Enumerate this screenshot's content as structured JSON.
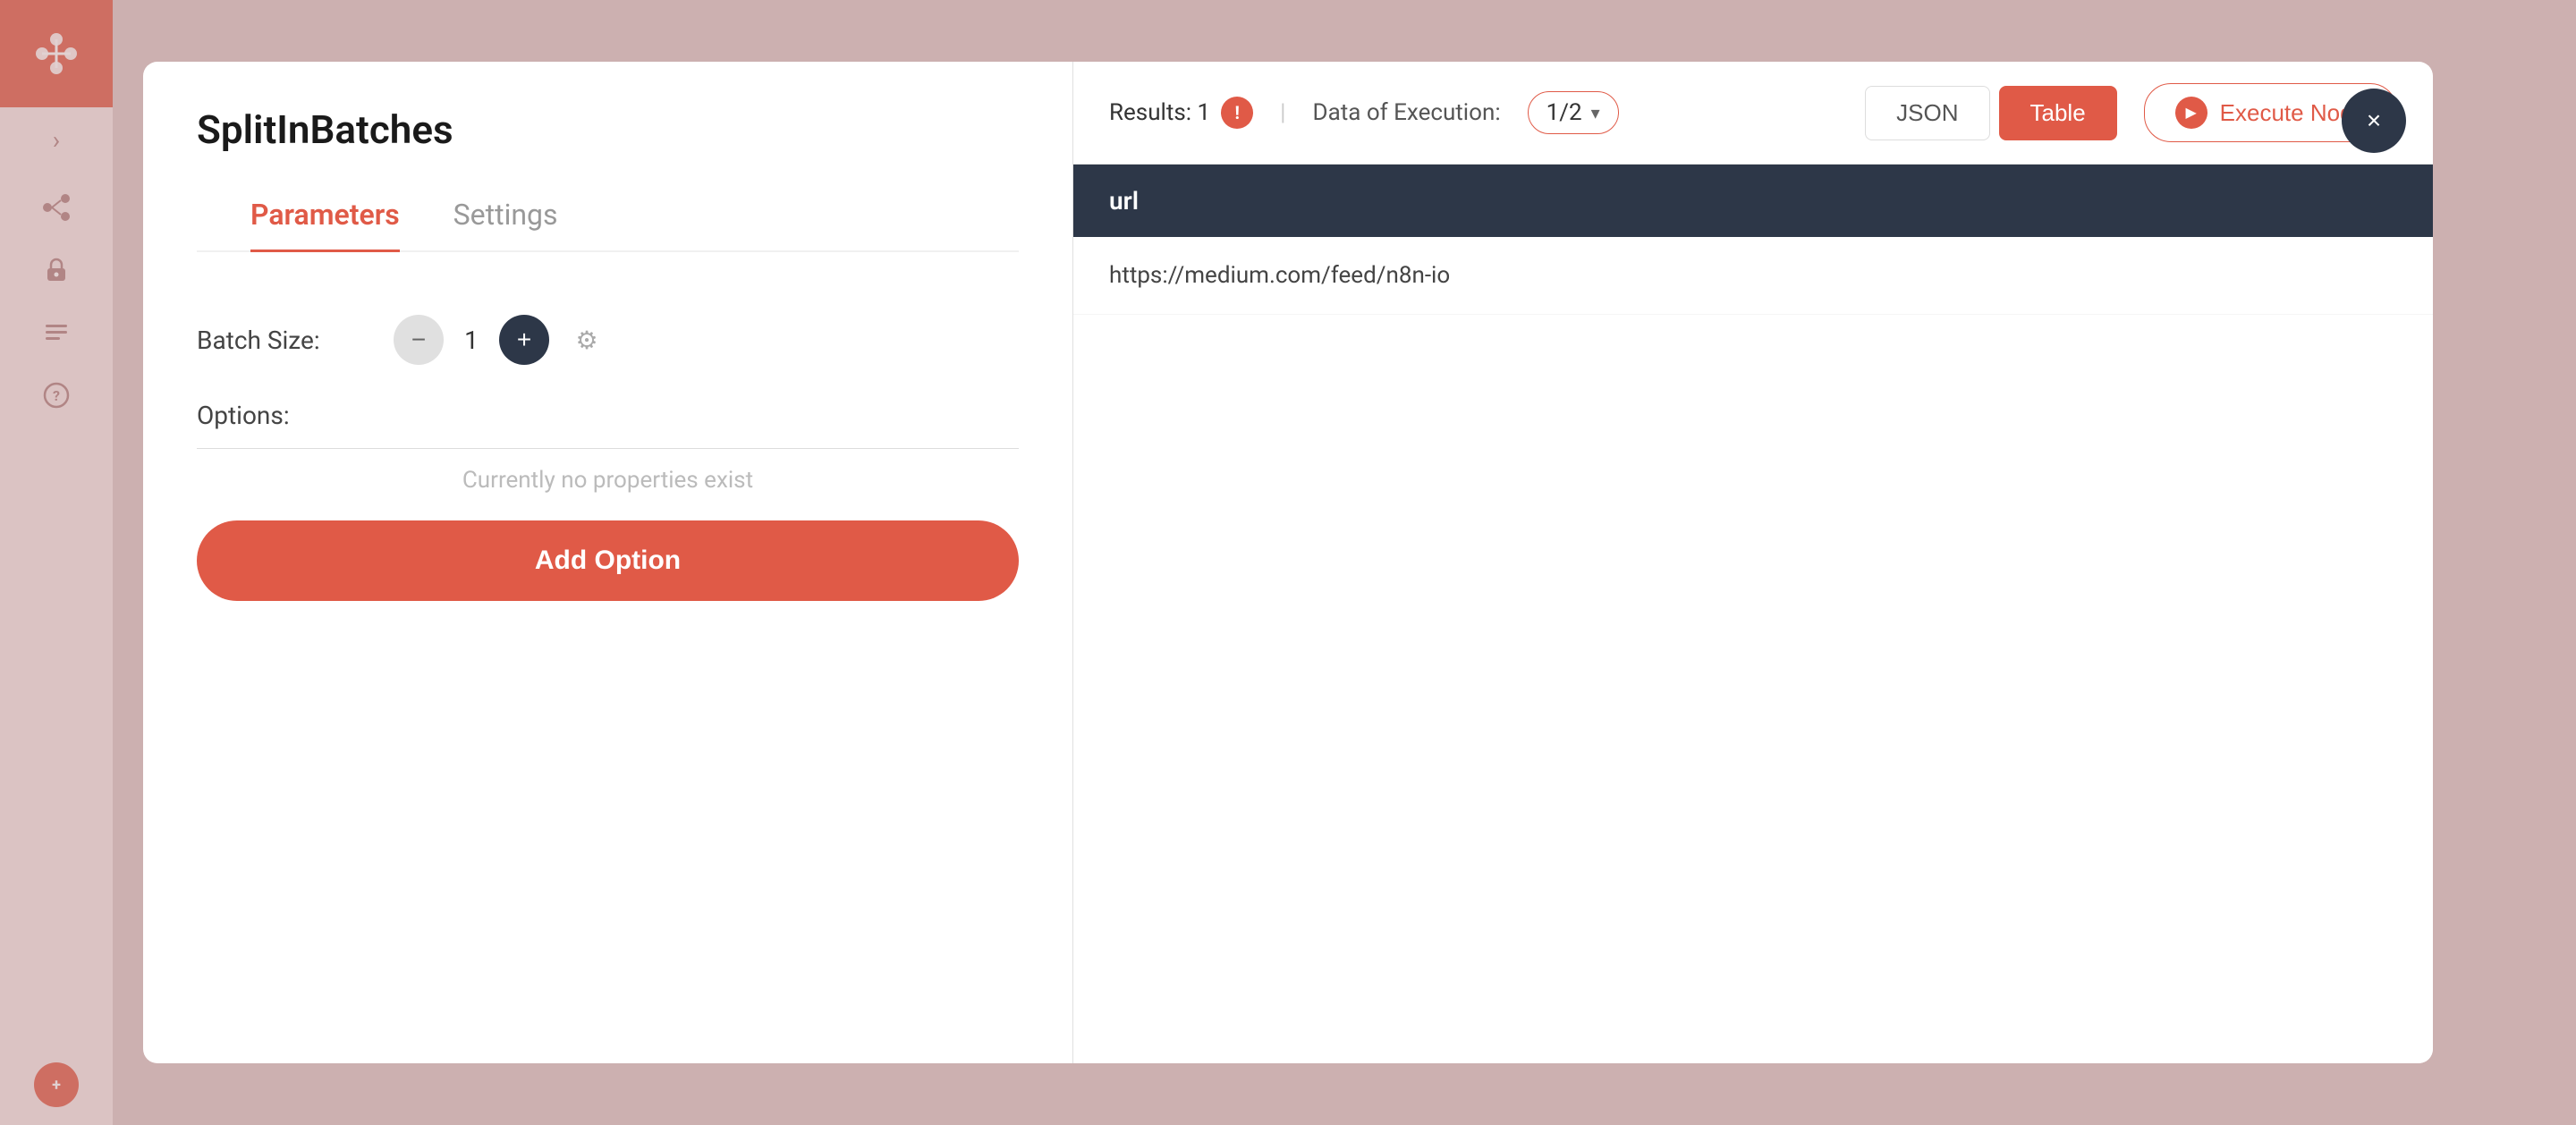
{
  "sidebar": {
    "logo_alt": "n8n logo",
    "expand_icon": "›",
    "icons": [
      {
        "name": "workflow-icon",
        "symbol": "⇄"
      },
      {
        "name": "credentials-icon",
        "symbol": "🔑"
      },
      {
        "name": "templates-icon",
        "symbol": "☰"
      },
      {
        "name": "help-icon",
        "symbol": "?"
      }
    ],
    "avatar_initials": "+"
  },
  "modal": {
    "close_label": "×",
    "title": "SplitInBatches",
    "tabs": [
      {
        "id": "parameters",
        "label": "Parameters",
        "active": true
      },
      {
        "id": "settings",
        "label": "Settings",
        "active": false
      }
    ],
    "parameters": {
      "batch_size_label": "Batch Size:",
      "batch_size_value": "1",
      "options_label": "Options:",
      "no_properties_text": "Currently no properties exist",
      "add_option_label": "Add Option"
    },
    "results": {
      "results_text": "Results: 1",
      "data_execution_label": "Data of Execution:",
      "execution_value": "1/2",
      "view_json_label": "JSON",
      "view_table_label": "Table",
      "execute_node_label": "Execute Node"
    },
    "table": {
      "column_header": "url",
      "rows": [
        {
          "url": "https://medium.com/feed/n8n-io"
        }
      ]
    }
  }
}
